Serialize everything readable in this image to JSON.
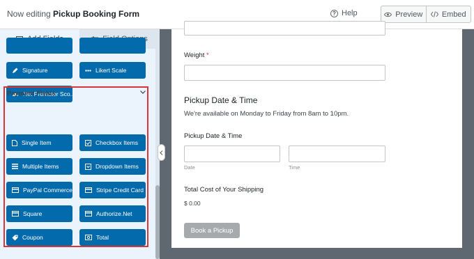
{
  "header": {
    "prefix": "Now editing",
    "form_name": "Pickup Booking Form",
    "help_label": "Help",
    "preview_label": "Preview",
    "embed_label": "Embed"
  },
  "sidebar": {
    "tabs": [
      {
        "label": "Add Fields",
        "icon": "list-icon",
        "active": true
      },
      {
        "label": "Field Options",
        "icon": "sliders-icon",
        "active": false
      }
    ],
    "fancy_fields": [
      {
        "label": "Signature",
        "icon": "pen-icon"
      },
      {
        "label": "Likert Scale",
        "icon": "dots-icon"
      },
      {
        "label": "Net Promoter Sco...",
        "icon": "gauge-icon"
      }
    ],
    "payment_section_title": "Payment Fields",
    "payment_fields": [
      {
        "label": "Single Item",
        "icon": "file-icon"
      },
      {
        "label": "Checkbox Items",
        "icon": "checkbox-icon"
      },
      {
        "label": "Multiple Items",
        "icon": "list-icon"
      },
      {
        "label": "Dropdown Items",
        "icon": "dropdown-icon"
      },
      {
        "label": "PayPal Commerce",
        "icon": "card-icon"
      },
      {
        "label": "Stripe Credit Card",
        "icon": "card-icon"
      },
      {
        "label": "Square",
        "icon": "card-icon"
      },
      {
        "label": "Authorize.Net",
        "icon": "card-icon"
      },
      {
        "label": "Coupon",
        "icon": "tag-icon"
      },
      {
        "label": "Total",
        "icon": "money-icon"
      }
    ]
  },
  "form": {
    "weight_label": "Weight",
    "required_mark": "*",
    "section_title": "Pickup Date & Time",
    "section_desc": "We're available on Monday to Friday from 8am to 10pm.",
    "datetime_label": "Pickup Date & Time",
    "date_sublabel": "Date",
    "time_sublabel": "Time",
    "total_label": "Total Cost of Your Shipping",
    "total_value": "$ 0.00",
    "submit_label": "Book a Pickup"
  },
  "colors": {
    "accent": "#036aab",
    "highlight": "#d63638",
    "sidebar_bg": "#ebf3fc",
    "preview_bg": "#5f6770"
  }
}
